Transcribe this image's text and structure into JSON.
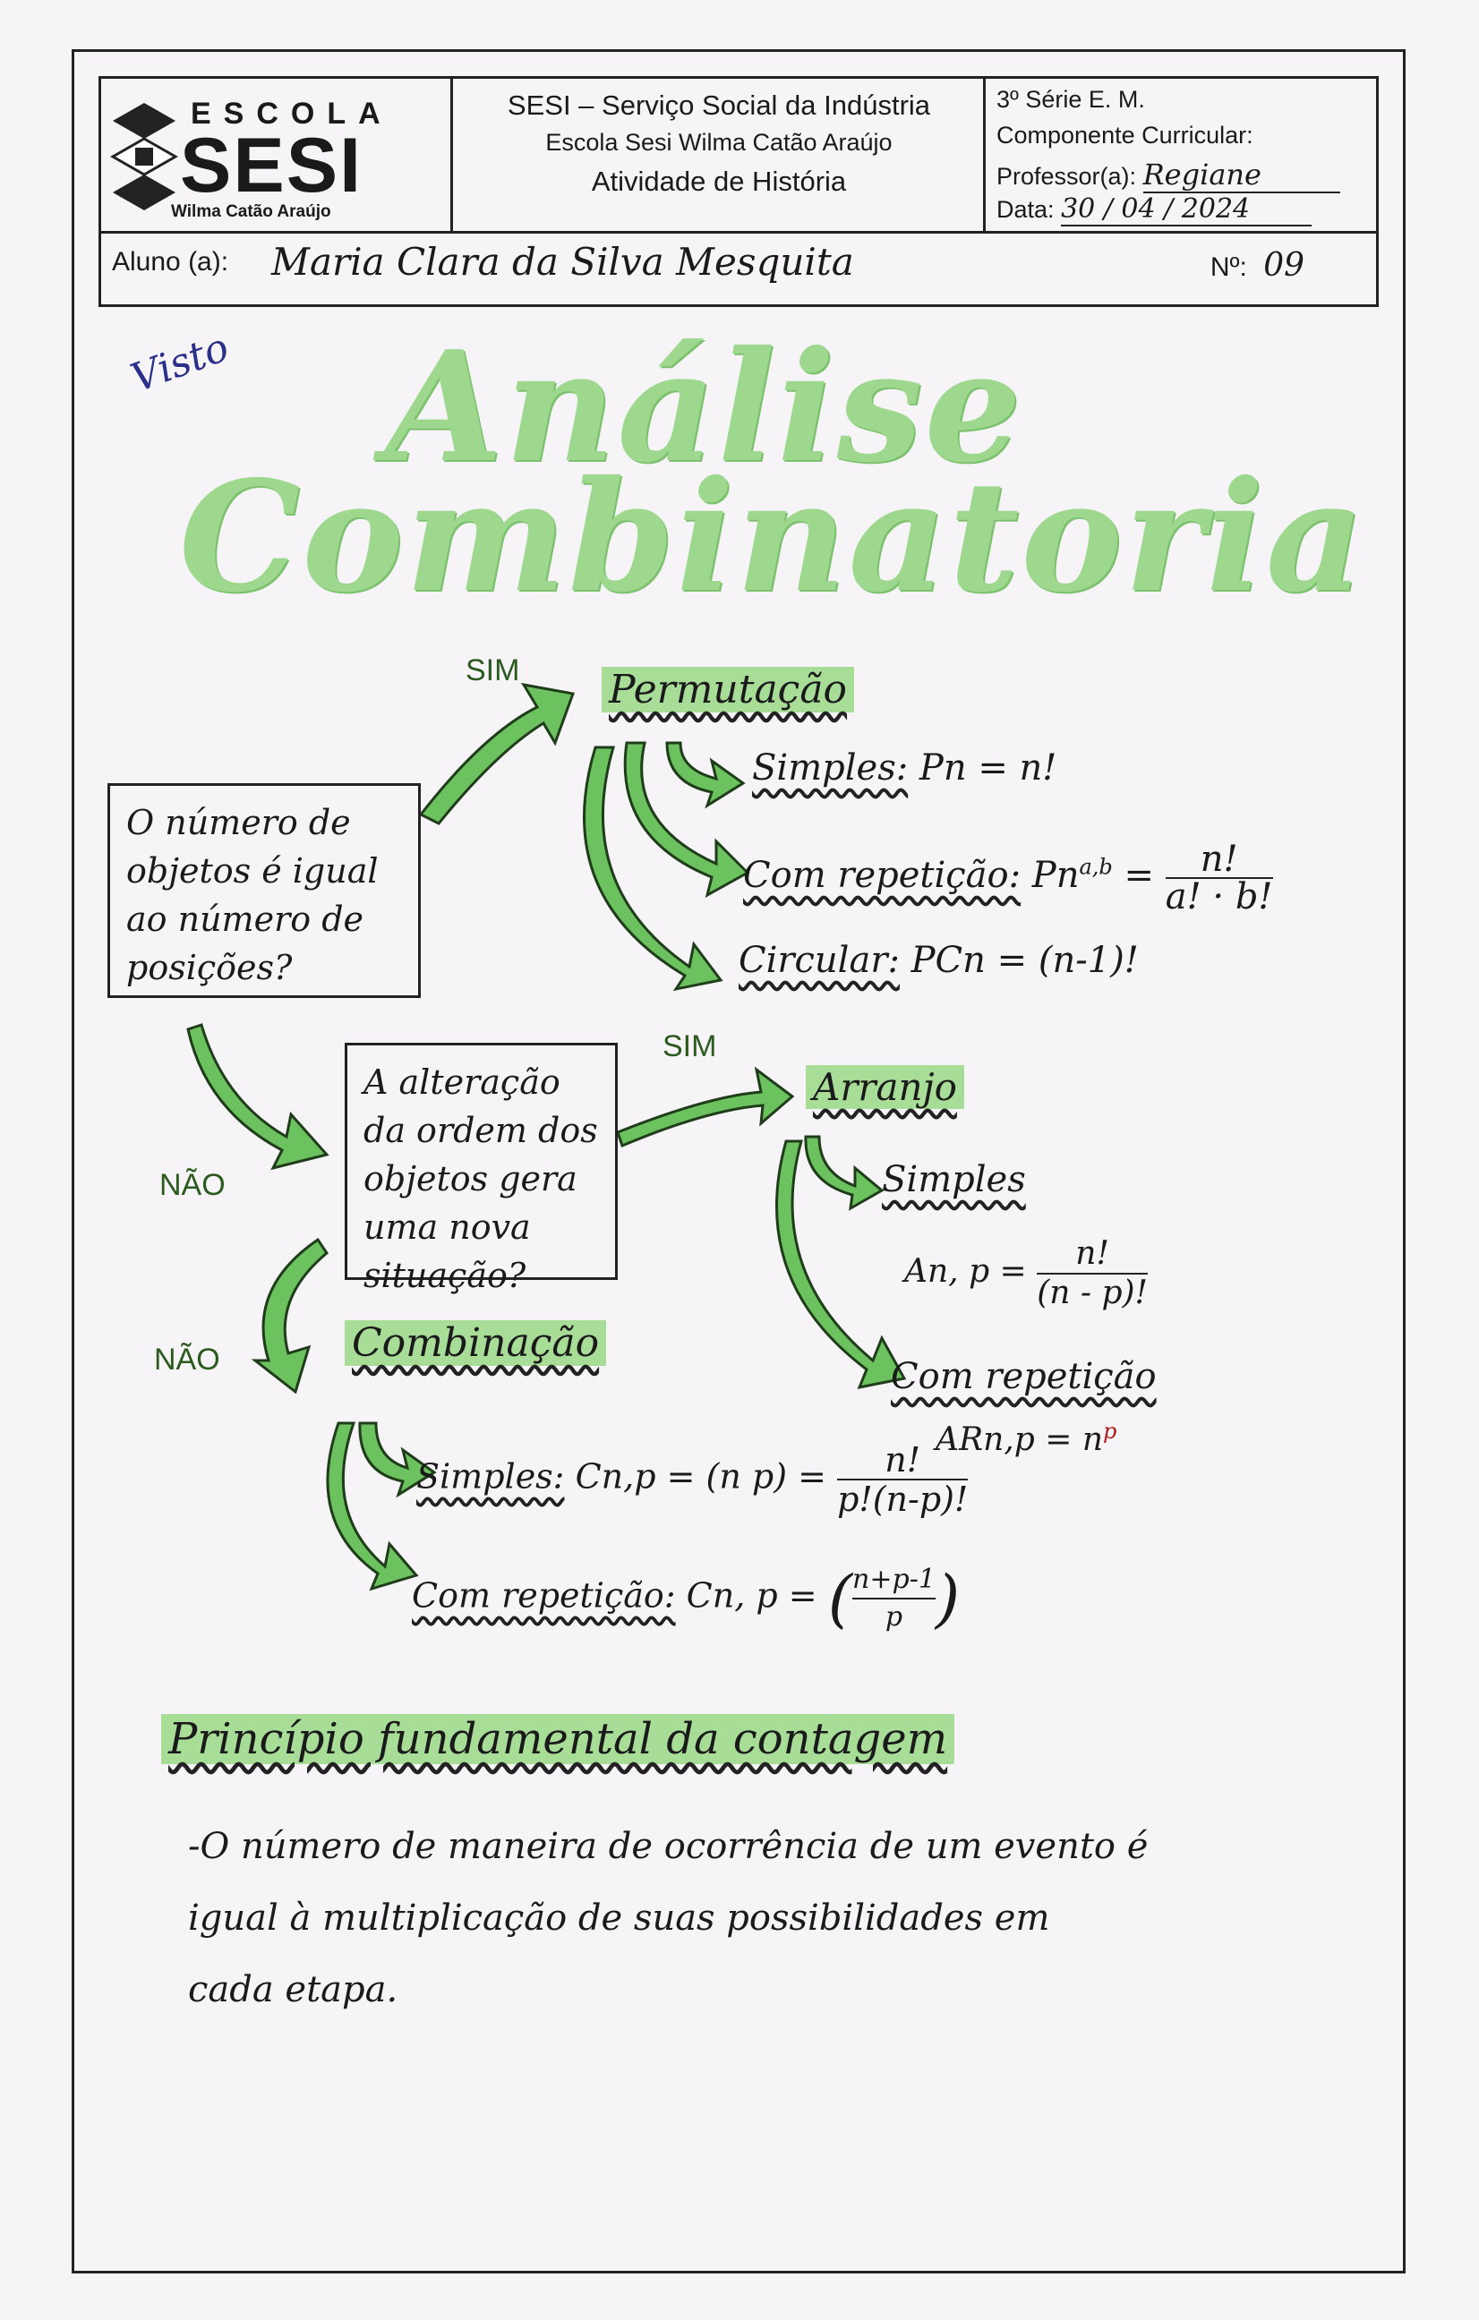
{
  "header": {
    "logo_top": "ESCOLA",
    "logo_main": "SESI",
    "logo_sub": "Wilma Catão Araújo",
    "inst_line1": "SESI – Serviço Social da Indústria",
    "inst_line2": "Escola Sesi Wilma Catão Araújo",
    "inst_line3": "Atividade de História",
    "serie": "3º Série E. M.",
    "componente_label": "Componente Curricular:",
    "professor_label": "Professor(a):",
    "professor_value": "Regiane",
    "data_label": "Data:",
    "data_value": "30 / 04 / 2024",
    "aluno_label": "Aluno (a):",
    "aluno_value": "Maria Clara da Silva Mesquita",
    "numero_label": "Nº:",
    "numero_value": "09"
  },
  "visto": "Visto",
  "title_line1": "Análise",
  "title_line2": "Combinatoria",
  "flow": {
    "q1": "O número de objetos é igual ao número de posições?",
    "q2": "A alteração da ordem dos objetos gera uma nova situação?",
    "yes1": "SIM",
    "yes2": "SIM",
    "no1": "NÃO",
    "no2": "NÃO",
    "permutacao": {
      "title": "Permutação",
      "simples_label": "Simples:",
      "simples_formula": "Pn = n!",
      "repeticao_label": "Com repetição:",
      "repeticao_formula_left": "Pn",
      "repeticao_sup": "a,b",
      "repeticao_num": "n!",
      "repeticao_den": "a! · b!",
      "circular_label": "Circular:",
      "circular_formula": "PCn = (n-1)!"
    },
    "arranjo": {
      "title": "Arranjo",
      "simples_label": "Simples",
      "simples_left": "An, p =",
      "simples_num": "n!",
      "simples_den": "(n - p)!",
      "repeticao_label": "Com repetição",
      "repeticao_formula": "ARn,p = n",
      "repeticao_sup": "p"
    },
    "combinacao": {
      "title": "Combinação",
      "simples_label": "Simples:",
      "simples_left": "Cn,p = (n p) =",
      "simples_num": "n!",
      "simples_den": "p!(n-p)!",
      "repeticao_label": "Com repetição:",
      "repeticao_left": "Cn, p =",
      "repeticao_top": "n+p-1",
      "repeticao_bottom": "p"
    }
  },
  "principio": {
    "title": "Princípio fundamental da contagem",
    "line1": "-O número de maneira de ocorrência de um evento é",
    "line2": "igual à multiplicação de suas possibilidades em",
    "line3": "cada etapa."
  },
  "colors": {
    "highlight": "#a8dd98",
    "arrow": "#5fbf52",
    "title": "#9ed88f"
  }
}
